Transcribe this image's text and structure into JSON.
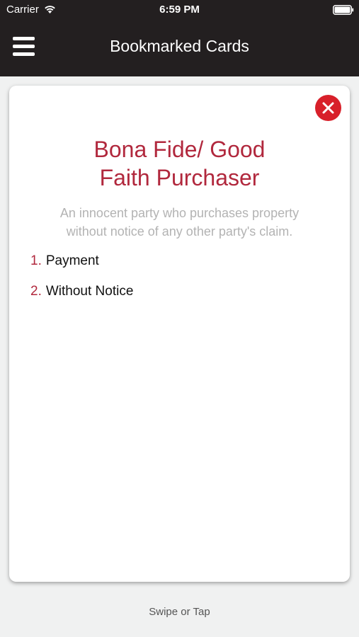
{
  "status_bar": {
    "carrier": "Carrier",
    "time": "6:59 PM",
    "icons": [
      "wifi-icon",
      "battery-icon"
    ]
  },
  "nav": {
    "title": "Bookmarked Cards",
    "menu_icon": "hamburger-menu-icon"
  },
  "card": {
    "title_line1": "Bona Fide/ Good",
    "title_line2": "Faith Purchaser",
    "definition_line1": "An innocent party who purchases property",
    "definition_line2": "without notice of any other party's claim.",
    "close_icon": "close-icon",
    "elements": [
      {
        "number": "1.",
        "text": "Payment"
      },
      {
        "number": "2.",
        "text": "Without Notice"
      }
    ]
  },
  "footer": {
    "hint": "Swipe or Tap"
  },
  "colors": {
    "nav_background": "#231f20",
    "accent": "#b1283d",
    "close_button": "#d8202a",
    "page_background": "#f0f1f1"
  }
}
